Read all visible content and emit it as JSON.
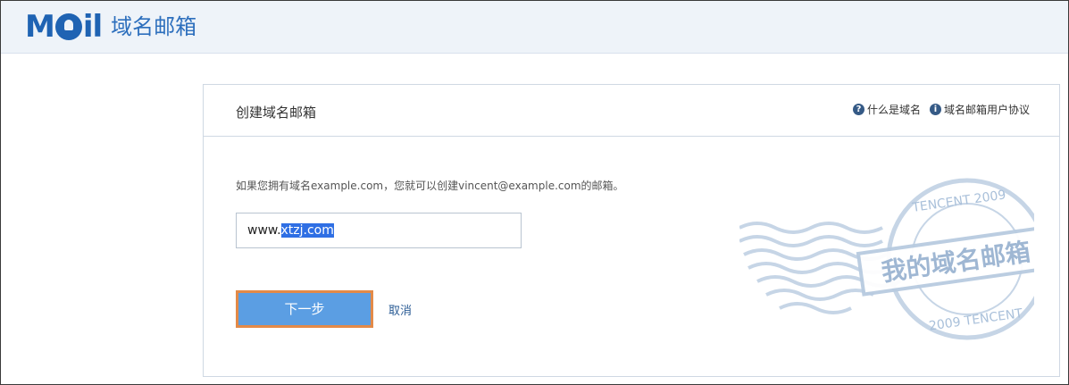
{
  "header": {
    "logo": {
      "text_left": "M",
      "text_right": "il"
    },
    "subtitle": "域名邮箱"
  },
  "panel": {
    "title": "创建域名邮箱",
    "links": [
      {
        "icon": "question-icon",
        "label": "什么是域名"
      },
      {
        "icon": "info-icon",
        "label": "域名邮箱用户协议"
      }
    ],
    "description": "如果您拥有域名example.com，您就可以创建vincent@example.com的邮箱。",
    "input": {
      "value_prefix": "www.",
      "value_selected": "xtzj.com"
    },
    "next_label": "下一步",
    "cancel_label": "取消",
    "stamp": {
      "center_text": "我的域名邮箱",
      "ring_top": "TENCENT 2009",
      "ring_bottom": "2009 TENCENT"
    }
  },
  "colors": {
    "brand": "#1f63b3",
    "button": "#5b9ee3",
    "button_border": "#e38a48",
    "header_bg": "#eef3f9"
  }
}
